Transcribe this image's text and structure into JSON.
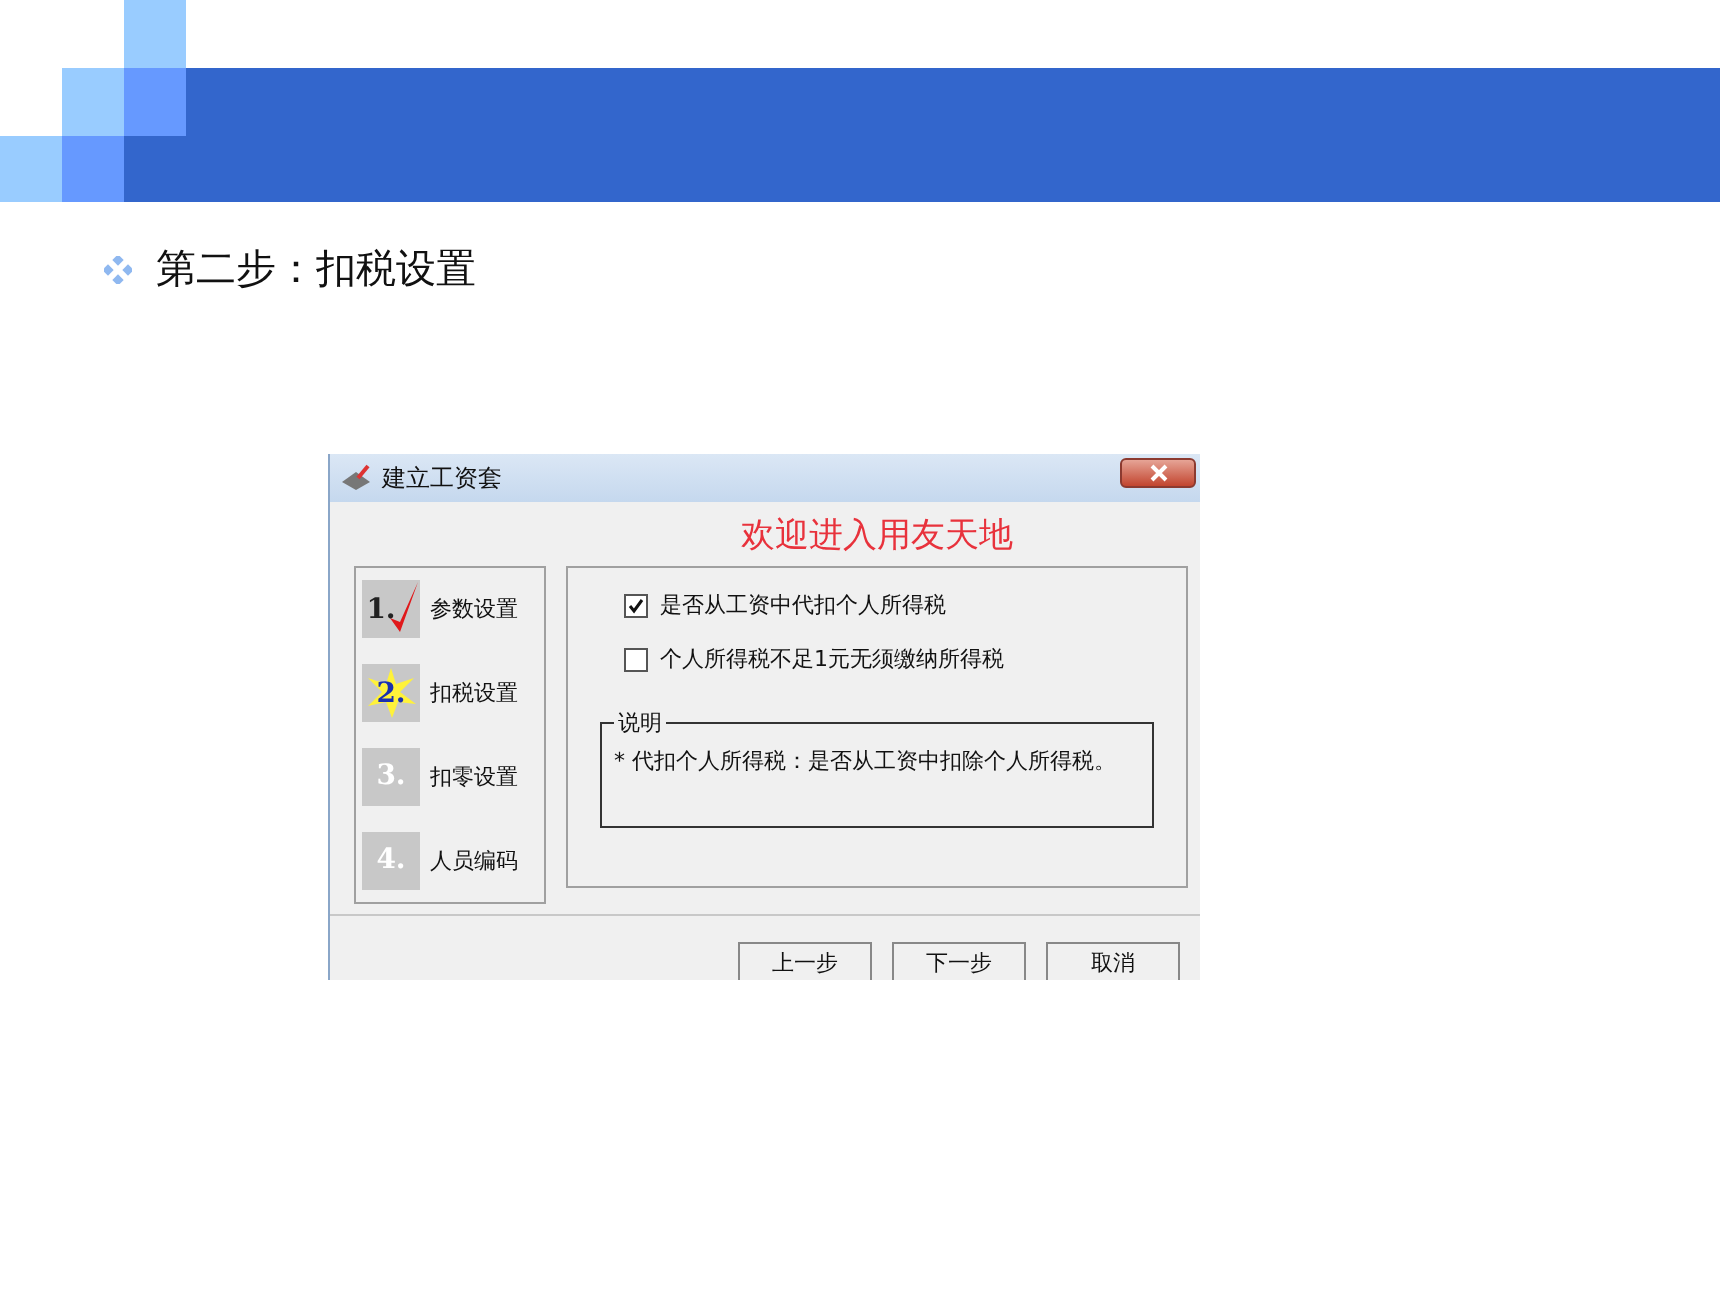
{
  "slide": {
    "title": "第二步：扣税设置"
  },
  "dialog": {
    "title": "建立工资套",
    "heading": "欢迎进入用友天地",
    "steps": [
      {
        "number": "1.",
        "label": "参数设置",
        "kind": "done"
      },
      {
        "number": "2.",
        "label": "扣税设置",
        "kind": "current"
      },
      {
        "number": "3.",
        "label": "扣零设置",
        "kind": "pending"
      },
      {
        "number": "4.",
        "label": "人员编码",
        "kind": "pending"
      }
    ],
    "options": [
      {
        "label": "是否从工资中代扣个人所得税",
        "checked": true
      },
      {
        "label": "个人所得税不足1元无须缴纳所得税",
        "checked": false
      }
    ],
    "note": {
      "title": "说明",
      "text": "* 代扣个人所得税：是否从工资中扣除个人所得税。"
    },
    "buttons": [
      "上一步",
      "下一步",
      "取消"
    ]
  }
}
